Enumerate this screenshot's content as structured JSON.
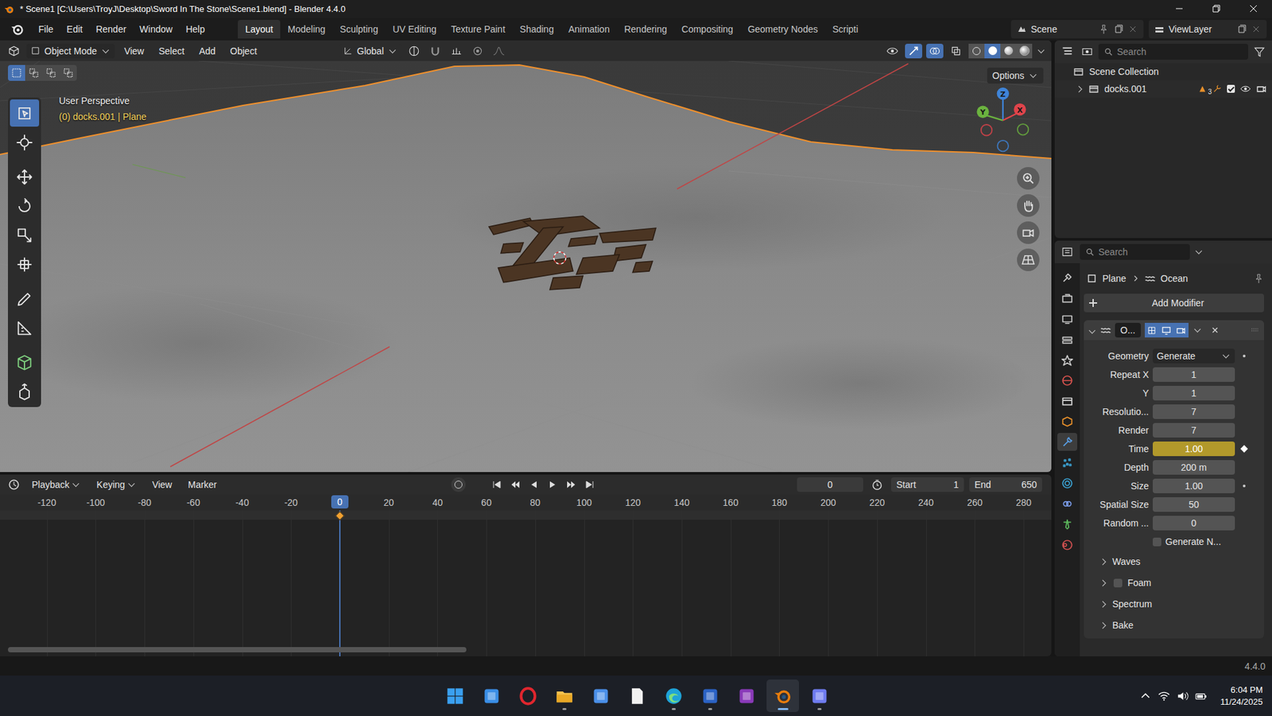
{
  "window": {
    "title": "* Scene1 [C:\\Users\\TroyJ\\Desktop\\Sword In The Stone\\Scene1.blend] - Blender 4.4.0"
  },
  "menu": [
    "File",
    "Edit",
    "Render",
    "Window",
    "Help"
  ],
  "workspaces": [
    {
      "label": "Layout",
      "selected": true
    },
    {
      "label": "Modeling",
      "selected": false
    },
    {
      "label": "Sculpting",
      "selected": false
    },
    {
      "label": "UV Editing",
      "selected": false
    },
    {
      "label": "Texture Paint",
      "selected": false
    },
    {
      "label": "Shading",
      "selected": false
    },
    {
      "label": "Animation",
      "selected": false
    },
    {
      "label": "Rendering",
      "selected": false
    },
    {
      "label": "Compositing",
      "selected": false
    },
    {
      "label": "Geometry Nodes",
      "selected": false
    },
    {
      "label": "Scripti",
      "selected": false
    }
  ],
  "scene": "Scene",
  "view_layer": "ViewLayer",
  "viewport": {
    "mode": "Object Mode",
    "menus": [
      "View",
      "Select",
      "Add",
      "Object"
    ],
    "orientation": "Global",
    "options": "Options",
    "overlay_title": "User Perspective",
    "overlay_info": "(0) docks.001 | Plane",
    "select_modes": [
      {
        "selected": true
      },
      {
        "selected": false
      },
      {
        "selected": false
      },
      {
        "selected": false
      }
    ],
    "shading": [
      {
        "selected": false
      },
      {
        "selected": true
      },
      {
        "selected": false
      },
      {
        "selected": false
      }
    ],
    "axes": [
      {
        "label": "X",
        "color": "#e0444b"
      },
      {
        "label": "Y",
        "color": "#6bb33f"
      },
      {
        "label": "Z",
        "color": "#3f84d8"
      }
    ]
  },
  "tools": [
    {
      "kind": "select",
      "selected": true
    },
    {
      "kind": "cursor",
      "selected": false
    },
    {
      "kind": "move",
      "selected": false
    },
    {
      "kind": "rotate",
      "selected": false
    },
    {
      "kind": "scale",
      "selected": false
    },
    {
      "kind": "transform",
      "selected": false
    },
    {
      "kind": "annotate",
      "selected": false
    },
    {
      "kind": "measure",
      "selected": false
    },
    {
      "kind": "addcube",
      "selected": false
    },
    {
      "kind": "extrude",
      "selected": false
    }
  ],
  "timeline": {
    "menus": [
      "Playback",
      "Keying",
      "View",
      "Marker"
    ],
    "current_frame": "0",
    "start_label": "Start",
    "start": "1",
    "end_label": "End",
    "end": "650",
    "playhead": "0",
    "ticks": [
      "-120",
      "-100",
      "-80",
      "-60",
      "-40",
      "-20",
      "0",
      "20",
      "40",
      "60",
      "80",
      "100",
      "120",
      "140",
      "160",
      "180",
      "200",
      "220",
      "240",
      "260",
      "280"
    ]
  },
  "outliner": {
    "search_placeholder": "Search",
    "root": "Scene Collection",
    "items": [
      {
        "name": "docks.001",
        "expanded": false,
        "child_count": "3",
        "enabled": true,
        "visible": true,
        "renderable": true
      }
    ]
  },
  "properties": {
    "search_placeholder": "Search",
    "breadcrumb": [
      "Plane",
      "Ocean"
    ],
    "add_modifier": "Add Modifier",
    "tabs": [
      {
        "kind": "tool",
        "color": "#c8c8c8",
        "selected": false
      },
      {
        "kind": "render",
        "color": "#c8c8c8",
        "selected": false
      },
      {
        "kind": "output",
        "color": "#c8c8c8",
        "selected": false
      },
      {
        "kind": "viewlayer",
        "color": "#c8c8c8",
        "selected": false
      },
      {
        "kind": "scene",
        "color": "#c8c8c8",
        "selected": false
      },
      {
        "kind": "world",
        "color": "#d9534f",
        "selected": false
      },
      {
        "kind": "collection",
        "color": "#d8d8d8",
        "selected": false
      },
      {
        "kind": "object",
        "color": "#e8902b",
        "selected": false
      },
      {
        "kind": "modifier",
        "color": "#5a9fe6",
        "selected": true
      },
      {
        "kind": "particles",
        "color": "#3aa0d0",
        "selected": false
      },
      {
        "kind": "physics",
        "color": "#3aa0d0",
        "selected": false
      },
      {
        "kind": "constraints",
        "color": "#7a9be8",
        "selected": false
      },
      {
        "kind": "data",
        "color": "#5cb85c",
        "selected": false
      },
      {
        "kind": "material",
        "color": "#d05050",
        "selected": false
      }
    ],
    "modifier": {
      "name": "O...",
      "expanded": true,
      "toggles": [
        {
          "kind": "editmode",
          "on": true
        },
        {
          "kind": "viewport",
          "on": true
        },
        {
          "kind": "render",
          "on": true
        }
      ]
    },
    "fields": [
      {
        "label": "Geometry",
        "value": "Generate",
        "kind": "dropdown",
        "decorator": "dot",
        "keyed": false,
        "checked": false
      },
      {
        "label": "Repeat X",
        "value": "1",
        "kind": "number",
        "decorator": "none",
        "keyed": false,
        "checked": false
      },
      {
        "label": "Y",
        "value": "1",
        "kind": "number",
        "decorator": "none",
        "keyed": false,
        "checked": false
      },
      {
        "label": "Resolutio...",
        "value": "7",
        "kind": "number",
        "decorator": "none",
        "keyed": false,
        "checked": false
      },
      {
        "label": "Render",
        "value": "7",
        "kind": "number",
        "decorator": "none",
        "keyed": false,
        "checked": false
      },
      {
        "label": "Time",
        "value": "1.00",
        "kind": "number",
        "decorator": "diamond",
        "keyed": true,
        "checked": false
      },
      {
        "label": "Depth",
        "value": "200 m",
        "kind": "number",
        "decorator": "none",
        "keyed": false,
        "checked": false
      },
      {
        "label": "Size",
        "value": "1.00",
        "kind": "number",
        "decorator": "dot",
        "keyed": false,
        "checked": false
      },
      {
        "label": "Spatial Size",
        "value": "50",
        "kind": "number",
        "decorator": "none",
        "keyed": false,
        "checked": false
      },
      {
        "label": "Random ...",
        "value": "0",
        "kind": "number",
        "decorator": "none",
        "keyed": false,
        "checked": false
      },
      {
        "label": "Generate N...",
        "value": "",
        "kind": "checkbox",
        "decorator": "none",
        "keyed": false,
        "checked": false
      }
    ],
    "subpanels": [
      {
        "label": "Waves",
        "kind": "plain",
        "expanded": false,
        "checked": false
      },
      {
        "label": "Foam",
        "kind": "checkbox",
        "expanded": false,
        "checked": false
      },
      {
        "label": "Spectrum",
        "kind": "plain",
        "expanded": false,
        "checked": false
      },
      {
        "label": "Bake",
        "kind": "plain",
        "expanded": false,
        "checked": false
      }
    ]
  },
  "status_bar": {
    "version": "4.4.0"
  },
  "taskbar": {
    "apps": [
      {
        "kind": "windows",
        "color": "#3aa0f0",
        "open": false,
        "active": false
      },
      {
        "kind": "taskview",
        "color": "#3a8ee6",
        "open": false,
        "active": false
      },
      {
        "kind": "opera",
        "color": "#e0262e",
        "open": false,
        "active": false
      },
      {
        "kind": "explorer",
        "color": "#f2c14e",
        "open": true,
        "active": false
      },
      {
        "kind": "store",
        "color": "#4a8fe8",
        "open": false,
        "active": false
      },
      {
        "kind": "notepad",
        "color": "#f2f2f2",
        "open": false,
        "active": false
      },
      {
        "kind": "edge",
        "color": "#1fa3d8",
        "open": true,
        "active": false
      },
      {
        "kind": "word",
        "color": "#2b62c4",
        "open": true,
        "active": false
      },
      {
        "kind": "onenote",
        "color": "#8a3ab9",
        "open": false,
        "active": false
      },
      {
        "kind": "blender",
        "color": "#e87d0d",
        "open": true,
        "active": true
      },
      {
        "kind": "snip",
        "color": "#6f7cf0",
        "open": true,
        "active": false
      }
    ],
    "time": "6:04 PM",
    "date": "11/24/2025"
  }
}
